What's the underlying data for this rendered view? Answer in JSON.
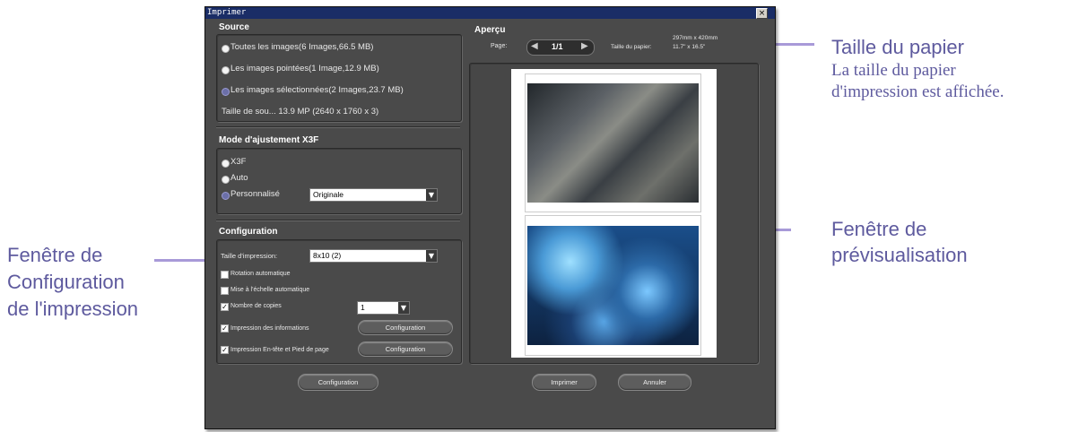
{
  "dialog": {
    "title": "Imprimer",
    "close_label": "×"
  },
  "source": {
    "title": "Source",
    "options": [
      {
        "label": "Toutes les images(6 Images,66.5 MB)",
        "selected": false
      },
      {
        "label": "Les images pointées(1 Image,12.9 MB)",
        "selected": false
      },
      {
        "label": "Les images sélectionnées(2 Images,23.7 MB)",
        "selected": true
      }
    ],
    "size_text": "Taille de sou... 13.9 MP (2640 x 1760 x 3)"
  },
  "x3f_mode": {
    "title": "Mode d'ajustement X3F",
    "options": [
      {
        "label": "X3F",
        "selected": false
      },
      {
        "label": "Auto",
        "selected": false
      },
      {
        "label": "Personnalisé",
        "selected": true
      }
    ],
    "custom_value": "Originale"
  },
  "configuration": {
    "title": "Configuration",
    "print_size_label": "Taille d'impression:",
    "print_size_value": "8x10 (2)",
    "auto_rotate": {
      "label": "Rotation automatique",
      "checked": false
    },
    "auto_scale": {
      "label": "Mise à l'échelle automatique",
      "checked": false
    },
    "copies": {
      "label": "Nombre de copies",
      "checked": true,
      "value": "1"
    },
    "print_info": {
      "label": "Impression des informations",
      "checked": true,
      "button": "Configuration"
    },
    "header_footer": {
      "label": "Impression En-tête et Pied de page",
      "checked": true,
      "button": "Configuration"
    },
    "bottom_button": "Configuration"
  },
  "preview": {
    "title": "Aperçu",
    "page_label": "Page:",
    "page_value": "1/1",
    "paper_size_label": "Taille du papier:",
    "paper_size_mm": "297mm x 420mm",
    "paper_size_in": "11.7\" x 16.5\"",
    "print_button": "Imprimer",
    "cancel_button": "Annuler"
  },
  "annotations": {
    "paper_title": "Taille du papier",
    "paper_desc_1": "La taille du papier",
    "paper_desc_2": "d'impression est affichée.",
    "preview_1": "Fenêtre de",
    "preview_2": "prévisualisation",
    "config_1": "Fenêtre de",
    "config_2": "Configuration",
    "config_3": "de l'impression"
  },
  "colors": {
    "annotation_text": "#5e5a9e",
    "annotation_arrow": "#a89ad8",
    "dialog_bg": "#4a4a4a",
    "titlebar": "#1a2d66"
  }
}
